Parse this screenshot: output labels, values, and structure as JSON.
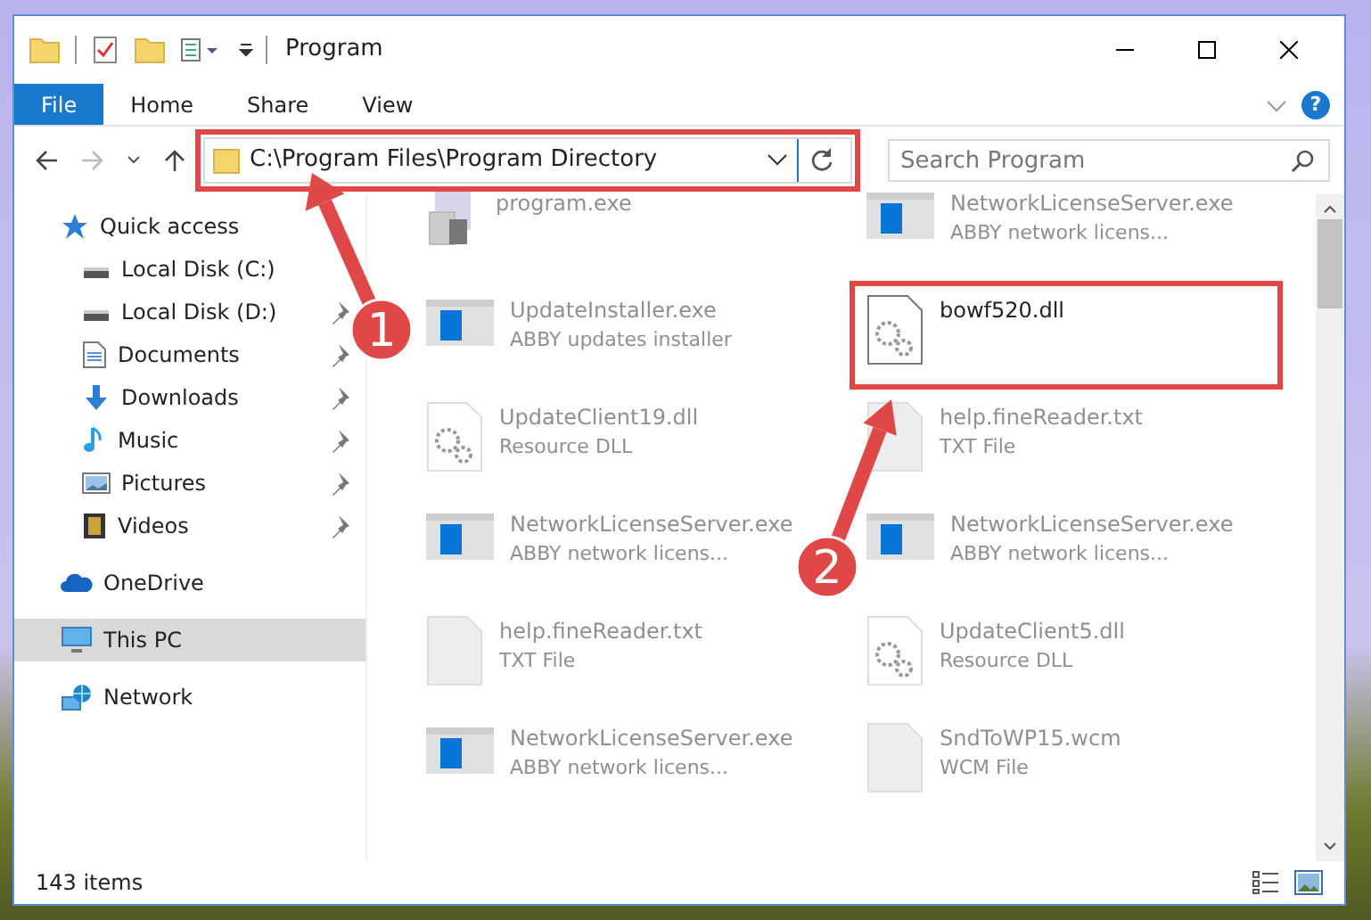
{
  "window": {
    "title": "Program"
  },
  "ribbon": {
    "tabs": [
      {
        "label": "File",
        "selected": true
      },
      {
        "label": "Home",
        "selected": false
      },
      {
        "label": "Share",
        "selected": false
      },
      {
        "label": "View",
        "selected": false
      }
    ],
    "help": "?"
  },
  "address": {
    "path": "C:\\Program Files\\Program Directory",
    "highlighted": true
  },
  "search": {
    "placeholder": "Search Program"
  },
  "sidebar": {
    "items": [
      {
        "label": "Quick access",
        "selected": false,
        "children": [
          {
            "label": "Local Disk (C:)",
            "pinned": false,
            "selected": false
          },
          {
            "label": "Local Disk (D:)",
            "pinned": true,
            "selected": false
          },
          {
            "label": "Documents",
            "pinned": true,
            "selected": false
          },
          {
            "label": "Downloads",
            "pinned": true,
            "selected": false
          },
          {
            "label": "Music",
            "pinned": true,
            "selected": false
          },
          {
            "label": "Pictures",
            "pinned": true,
            "selected": false
          },
          {
            "label": "Videos",
            "pinned": true,
            "selected": false
          }
        ]
      },
      {
        "label": "OneDrive",
        "selected": false
      },
      {
        "label": "This PC",
        "selected": true
      },
      {
        "label": "Network",
        "selected": false
      }
    ]
  },
  "files": [
    {
      "name": "program.exe",
      "kind": "program",
      "highlighted": false
    },
    {
      "name": "NetworkLicenseServer.exe",
      "type": "ABBY network licens...",
      "kind": "app",
      "highlighted": false
    },
    {
      "name": "UpdateInstaller.exe",
      "type": "ABBY updates installer",
      "kind": "app",
      "highlighted": false
    },
    {
      "name": "bowf520.dll",
      "kind": "dll",
      "highlighted": true
    },
    {
      "name": "UpdateClient19.dll",
      "type": "Resource DLL",
      "kind": "dll",
      "highlighted": false
    },
    {
      "name": "help.fineReader.txt",
      "type": "TXT File",
      "kind": "txt",
      "highlighted": false
    },
    {
      "name": "NetworkLicenseServer.exe",
      "type": "ABBY network licens...",
      "kind": "app",
      "highlighted": false
    },
    {
      "name": "NetworkLicenseServer.exe",
      "type": "ABBY network licens...",
      "kind": "app",
      "highlighted": false
    },
    {
      "name": "help.fineReader.txt",
      "type": "TXT File",
      "kind": "txt",
      "highlighted": false
    },
    {
      "name": "UpdateClient5.dll",
      "type": "Resource DLL",
      "kind": "dll",
      "highlighted": false
    },
    {
      "name": "NetworkLicenseServer.exe",
      "type": "ABBY network licens...",
      "kind": "app",
      "highlighted": false
    },
    {
      "name": "SndToWP15.wcm",
      "type": "WCM File",
      "kind": "txt",
      "highlighted": false
    }
  ],
  "annotations": [
    {
      "number": "1"
    },
    {
      "number": "2"
    }
  ],
  "status_bar": {
    "count": "143 items"
  }
}
